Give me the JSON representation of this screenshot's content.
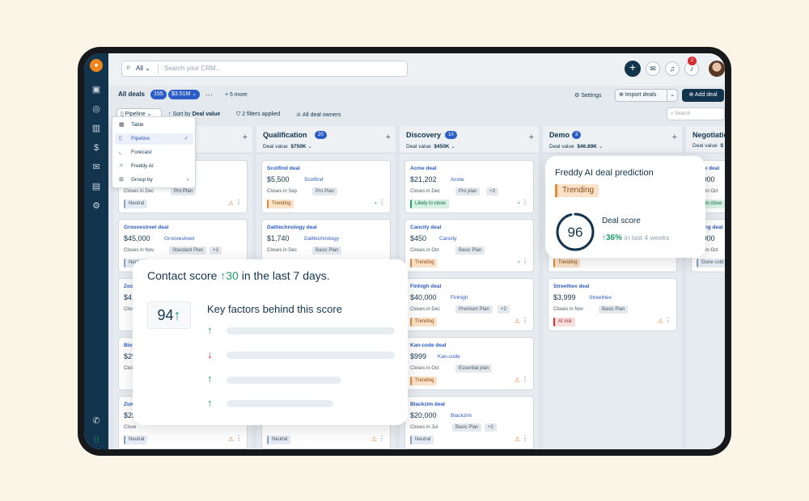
{
  "topbar": {
    "search_scope": "All",
    "search_placeholder": "Search your CRM...",
    "notif_count": "2"
  },
  "toolbar": {
    "all_deals": "All deals",
    "count": "155",
    "value": "$3.51M",
    "more": "+ 5 more",
    "settings": "Settings",
    "import": "Import deals",
    "add": "Add deal",
    "pipeline": "Pipeline",
    "sort": "Sort by",
    "sort_field": "Deal value",
    "filters": "2 filters applied",
    "owners": "All deal owners",
    "search_placeholder": "Search"
  },
  "menu": [
    {
      "label": "Table",
      "icon": "table-icon"
    },
    {
      "label": "Pipeline",
      "icon": "pipeline-icon",
      "selected": true
    },
    {
      "label": "Forecast",
      "icon": "forecast-icon"
    },
    {
      "label": "Freddy AI",
      "icon": "freddy-icon"
    },
    {
      "label": "Group by",
      "icon": "group-icon"
    }
  ],
  "columns": [
    {
      "name": "Qualification",
      "count": "20",
      "value_label": "Deal value",
      "value": "$750K"
    },
    {
      "name": "Discovery",
      "count": "10",
      "value_label": "Deal value",
      "value": "$450K"
    },
    {
      "name": "Demo",
      "count": "3",
      "value_label": "Deal value",
      "value": "$46.89K"
    },
    {
      "name": "Negotiatio",
      "count": "",
      "value_label": "Deal value",
      "value": "$"
    }
  ],
  "cards": {
    "c0a": {
      "close": "Closes in Dec",
      "plan": "Pro Plan",
      "tag": "Neutral"
    },
    "c0b": {
      "name": "Groovestreet deal",
      "amount": "$45,000",
      "company": "Groovestreet",
      "close": "Closes in Nov",
      "plan": "Standard Plan",
      "extra": "+3",
      "tag": "Neutral"
    },
    "c0c": {
      "name": "Zoo",
      "amount": "$4,",
      "close": "Close"
    },
    "c0d": {
      "name": "Biop",
      "amount": "$29",
      "close": "Close"
    },
    "c0e": {
      "name": "Zum",
      "amount": "$25",
      "close": "Close",
      "tag": "Neutral"
    },
    "c1a": {
      "name": "Scotfind deal",
      "amount": "$5,500",
      "company": "Scotfind",
      "close": "Closes in Sep",
      "plan": "Pro Plan",
      "tag": "Trending"
    },
    "c1b": {
      "name": "Dalttechnology deal",
      "amount": "$1,740",
      "company": "Dalttechnology",
      "close": "Closes in Dec",
      "plan": "Basic Plan"
    },
    "c1c": {
      "tag": "Neutral"
    },
    "c2a": {
      "name": "Acme deal",
      "amount": "$21,202",
      "company": "Acme",
      "close": "Closes in Dec",
      "plan": "Pro plan",
      "extra": "+3",
      "tag": "Likely to close"
    },
    "c2b": {
      "name": "Cancity deal",
      "amount": "$450",
      "company": "Cancity",
      "close": "Closes in Oct",
      "plan": "Basic Plan",
      "tag": "Trending"
    },
    "c2c": {
      "name": "Finhigh deal",
      "amount": "$40,000",
      "company": "Finhigh",
      "close": "Closes in Dec",
      "plan": "Premium Plan",
      "extra": "+2",
      "tag": "Trending"
    },
    "c2d": {
      "name": "Kan-code deal",
      "amount": "$999",
      "company": "Kan-code",
      "close": "Closes in Oct",
      "plan": "Essential plan",
      "tag": "Trending"
    },
    "c2e": {
      "name": "Blackzim deal",
      "amount": "$20,000",
      "company": "Blackzim",
      "close": "Closes in Jul",
      "plan": "Basic Plan",
      "extra": "+2",
      "tag": "Neutral"
    },
    "c3a": {
      "tag": "Trending"
    },
    "c3b": {
      "name": "Streethex deal",
      "amount": "$3,999",
      "company": "Streethex",
      "close": "Closes in Nov",
      "plan": "Basic Plan",
      "tag": "At risk"
    },
    "c4a": {
      "name": "atfix deal",
      "amount": "0,000",
      "close": "ses in Oct",
      "tag": "y to close"
    },
    "c4b": {
      "name": "nding deal",
      "amount": "0,000",
      "close": "ses in Oct",
      "tag": "Gone cold"
    }
  },
  "contact_score": {
    "title_pre": "Contact score",
    "delta": "30",
    "title_post": "in the last 7 days.",
    "score": "94",
    "factors_title": "Key factors behind this score",
    "factors": [
      "up",
      "down",
      "up",
      "up"
    ]
  },
  "prediction": {
    "title": "Freddy AI deal prediction",
    "tag": "Trending",
    "score": 96,
    "label": "Deal score",
    "change": "36%",
    "period": "in last 4 weeks"
  },
  "colors": {
    "navy": "#12344d",
    "blue": "#2c5cc5",
    "green": "#1d9e6a",
    "red": "#d72d30",
    "orange": "#f0851e"
  }
}
